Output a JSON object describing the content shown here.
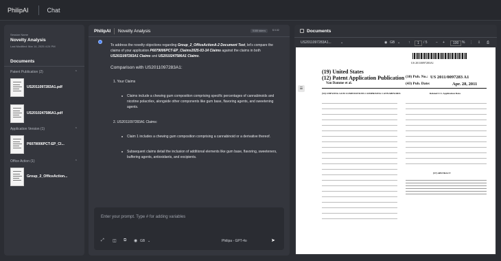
{
  "topbar": {
    "brand": "PhilipAI",
    "tab": "Chat"
  },
  "session": {
    "label": "Session Name",
    "name": "Novelty Analysis",
    "modified": "Last Modified: Mar 14, 2025 4:24 PM"
  },
  "documents": {
    "title": "Documents",
    "categories": [
      {
        "label": "Patent Publication (2)",
        "files": [
          "US2011097283A1.pdf",
          "US2010247586A1.pdf"
        ]
      },
      {
        "label": "Application Version (1)",
        "files": [
          "P6079006PCT-EP_Cl..."
        ]
      },
      {
        "label": "Office Action (1)",
        "files": [
          "Group_2_OfficeAction..."
        ]
      }
    ]
  },
  "chat": {
    "brand": "PhilipAI",
    "title": "Novelty Analysis",
    "tokens": "5188 tokens",
    "cost": "$ 0.02",
    "intro_a": "To address the novelty objections regarding ",
    "intro_b": "Group_2_OfficeActionA-2 Document Text",
    "intro_c": ", let's compare the claims of your application ",
    "intro_d": "P6079006PCT-EP_Claims2025-03-14 Claims",
    "intro_e": " against the claims in both ",
    "intro_f": "US2011097283A1 Claims",
    "intro_g": " and ",
    "intro_h": "US2010247586A1 Claims",
    "intro_i": ".",
    "comparison_heading": "Comparison with US2011097283A1:",
    "item1": "1.   Your Claims",
    "item1_text": "Claims include a chewing gum composition comprising specific percentages of cannabinoids and nicotine polacrilex, alongside other components like gum base, flavoring agents, and sweetening agents.",
    "item2": "2.   US2011097283A1 Claims:",
    "item2_text_a": "Claim 1 includes a chewing gum composition comprising a cannabinoid or a derivative thereof.",
    "item2_text_b": "Subsequent claims detail the inclusion of additional elements like gum base, flavoring, sweeteners, buffering agents, antioxidants, and excipients.",
    "input_placeholder": "Enter your prompt. Type # for adding variables",
    "language": "GB",
    "model": "Philipa - GPT-4o"
  },
  "viewer": {
    "title": "Documents",
    "doc_select": "US2011097283A1...",
    "language": "GB",
    "page": "1",
    "pages": "/ 5",
    "zoom": "100",
    "zoom_unit": "%",
    "pdf": {
      "pubnum_top": "US 20110097283A1",
      "country": "(19) United States",
      "kind": "(12) Patent Application Publication",
      "inventor": "Van Damme et al.",
      "pubno_label": "(10) Pub. No.:",
      "pubno": "US 2011/0097283 A1",
      "pubdate_label": "(43) Pub. Date:",
      "pubdate": "Apr. 28, 2011",
      "title": "(54) CHEWING GUM COMPOSITIONS COMPRISING CANNABINOIDS",
      "related": "Related U.S. Application Data",
      "abstract": "(57) ABSTRACT"
    }
  },
  "colors": {
    "accent": "#4f86ff",
    "panel": "#34363d",
    "bg": "#2b2d33"
  }
}
